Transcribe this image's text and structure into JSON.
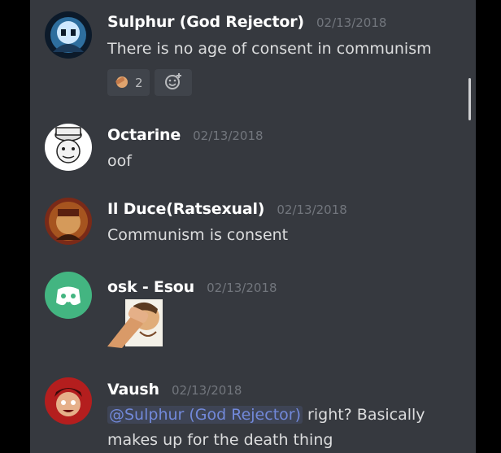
{
  "messages": [
    {
      "username": "Sulphur (God Rejector)",
      "timestamp": "02/13/2018",
      "text": "There is no age of consent in communism",
      "reaction": {
        "icon": "facepalm-emoji",
        "count": "2"
      },
      "add_reaction_icon": "add-reaction-icon"
    },
    {
      "username": "Octarine",
      "timestamp": "02/13/2018",
      "text": "oof"
    },
    {
      "username": "Il Duce(Ratsexual)",
      "timestamp": "02/13/2018",
      "text": "Communism is consent"
    },
    {
      "username": "osk - Esou",
      "timestamp": "02/13/2018",
      "sticker": "facepalm-sticker"
    },
    {
      "username": "Vaush",
      "timestamp": "02/13/2018",
      "mention": "@Sulphur (God Rejector)",
      "text_after_mention": " right? Basically",
      "text_line2": "makes up for the death thing"
    }
  ],
  "colors": {
    "background": "#36393f",
    "username": "#ffffff",
    "text": "#dcddde",
    "timestamp": "#72767d",
    "mention": "#7289da",
    "discord_blurple": "#43b581"
  }
}
